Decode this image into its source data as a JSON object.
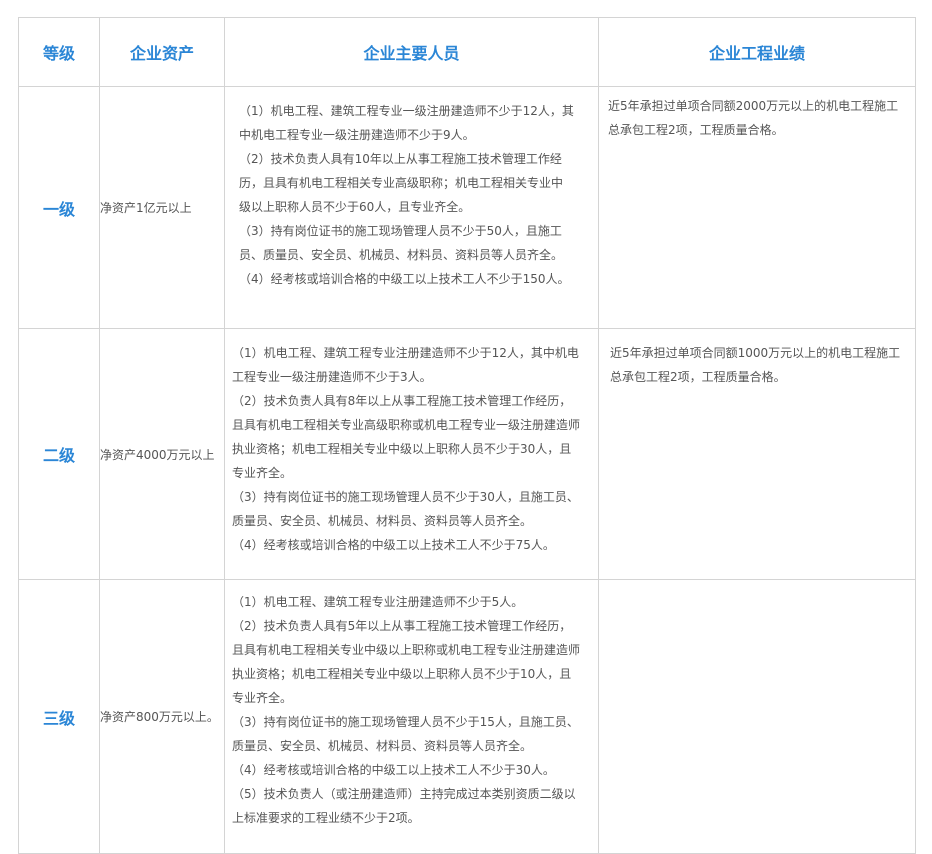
{
  "headers": [
    "等级",
    "企业资产",
    "企业主要人员",
    "企业工程业绩"
  ],
  "rows": [
    {
      "level": "一级",
      "asset": "净资产1亿元以上",
      "staff": [
        "（1）机电工程、建筑工程专业一级注册建造师不少于12人，其中机电工程专业一级注册建造师不少于9人。",
        "（2）技术负责人具有10年以上从事工程施工技术管理工作经历，且具有机电工程相关专业高级职称；机电工程相关专业中级以上职称人员不少于60人，且专业齐全。",
        "（3）持有岗位证书的施工现场管理人员不少于50人，且施工员、质量员、安全员、机械员、材料员、资料员等人员齐全。",
        "（4）经考核或培训合格的中级工以上技术工人不少于150人。"
      ],
      "performance": "近5年承担过单项合同额2000万元以上的机电工程施工总承包工程2项，工程质量合格。"
    },
    {
      "level": "二级",
      "asset": "净资产4000万元以上",
      "staff": [
        "（1）机电工程、建筑工程专业注册建造师不少于12人，其中机电工程专业一级注册建造师不少于3人。",
        "（2）技术负责人具有8年以上从事工程施工技术管理工作经历，且具有机电工程相关专业高级职称或机电工程专业一级注册建造师执业资格；机电工程相关专业中级以上职称人员不少于30人，且专业齐全。",
        "（3）持有岗位证书的施工现场管理人员不少于30人，且施工员、质量员、安全员、机械员、材料员、资料员等人员齐全。",
        "（4）经考核或培训合格的中级工以上技术工人不少于75人。"
      ],
      "performance": "近5年承担过单项合同额1000万元以上的机电工程施工总承包工程2项，工程质量合格。"
    },
    {
      "level": "三级",
      "asset": "净资产800万元以上。",
      "staff": [
        "（1）机电工程、建筑工程专业注册建造师不少于5人。",
        "（2）技术负责人具有5年以上从事工程施工技术管理工作经历，且具有机电工程相关专业中级以上职称或机电工程专业注册建造师执业资格；机电工程相关专业中级以上职称人员不少于10人，且专业齐全。",
        "（3）持有岗位证书的施工现场管理人员不少于15人，且施工员、质量员、安全员、机械员、材料员、资料员等人员齐全。",
        "（4）经考核或培训合格的中级工以上技术工人不少于30人。",
        "（5）技术负责人（或注册建造师）主持完成过本类别资质二级以上标准要求的工程业绩不少于2项。"
      ],
      "performance": ""
    }
  ],
  "colors": {
    "heading": "#2b86d6",
    "body_text": "#555555",
    "border": "#d4d4d4"
  }
}
